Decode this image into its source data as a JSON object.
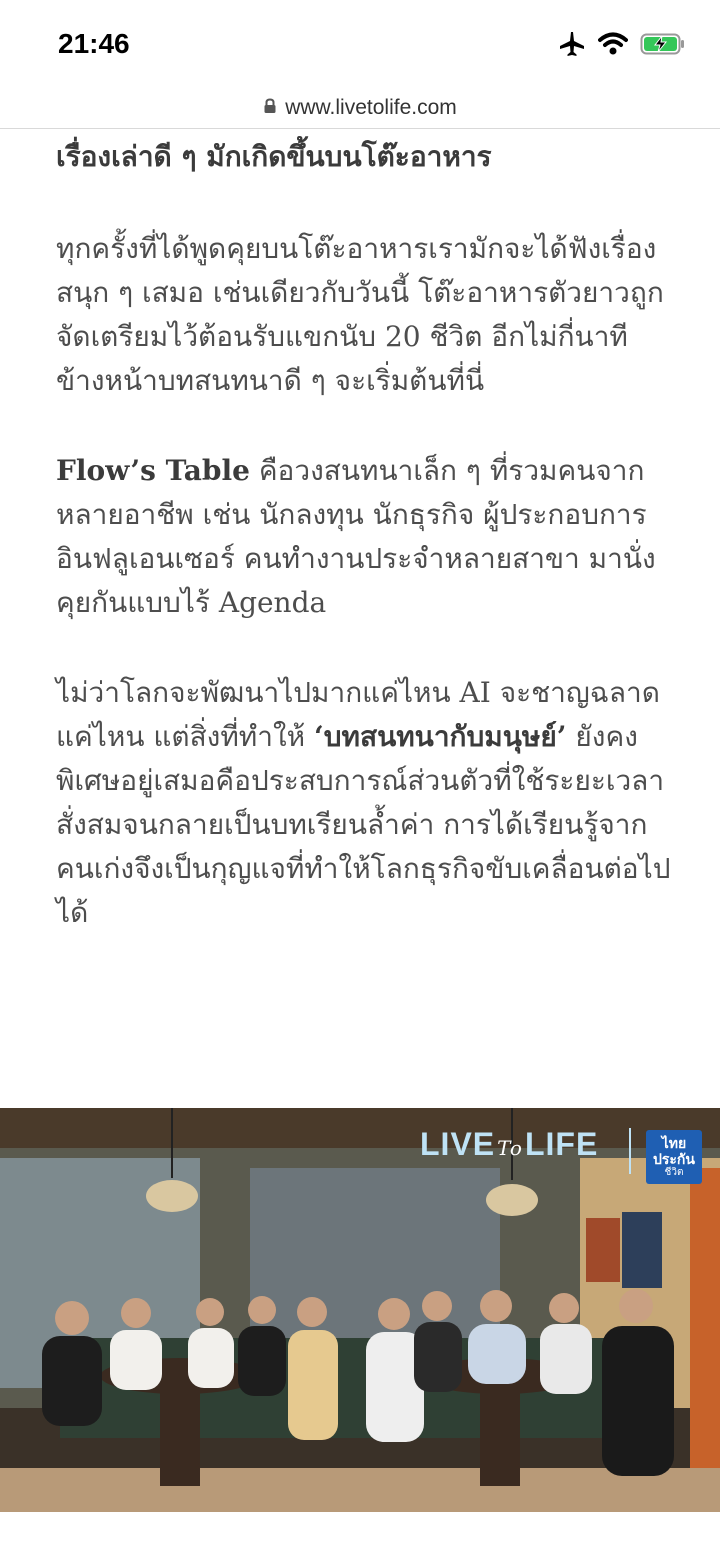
{
  "status_bar": {
    "time": "21:46"
  },
  "browser": {
    "url": "www.livetolife.com"
  },
  "article": {
    "heading": "เรื่องเล่าดี ๆ มักเกิดขึ้นบนโต๊ะอาหาร",
    "p1": "ทุกครั้งที่ได้พูดคุยบนโต๊ะอาหารเรามักจะได้ฟังเรื่องสนุก ๆ เสมอ เช่นเดียวกับวันนี้ โต๊ะอาหารตัวยาวถูกจัดเตรียมไว้ต้อนรับแขกนับ 20 ชีวิต อีกไม่กี่นาทีข้างหน้าบทสนทนาดี ๆ จะเริ่มต้นที่นี่",
    "p2_bold": "Flow’s Table",
    "p2_rest": " คือวงสนทนาเล็ก ๆ ที่รวมคนจากหลายอาชีพ เช่น นักลงทุน นักธุรกิจ ผู้ประกอบการ อินฟลูเอนเซอร์ คนทำงานประจำหลายสาขา มานั่งคุยกันแบบไร้ Agenda",
    "p3_start": "ไม่ว่าโลกจะพัฒนาไปมากแค่ไหน AI จะชาญฉลาดแค่ไหน แต่สิ่งที่ทำให้ ",
    "p3_bold": "‘บทสนทนากับมนุษย์’",
    "p3_end": " ยังคงพิเศษอยู่เสมอคือประสบการณ์ส่วนตัวที่ใช้ระยะเวลาสั่งสมจนกลายเป็นบทเรียนล้ำค่า การได้เรียนรู้จากคนเก่งจึงเป็นกุญแจที่ทำให้โลกธุรกิจขับเคลื่อนต่อไปได้"
  },
  "photo": {
    "logo_live": "LIVE",
    "logo_to": "To",
    "logo_life": "LIFE",
    "badge_line1": "ไทย",
    "badge_line2": "ประกัน",
    "badge_line3": "ชีวิต"
  }
}
